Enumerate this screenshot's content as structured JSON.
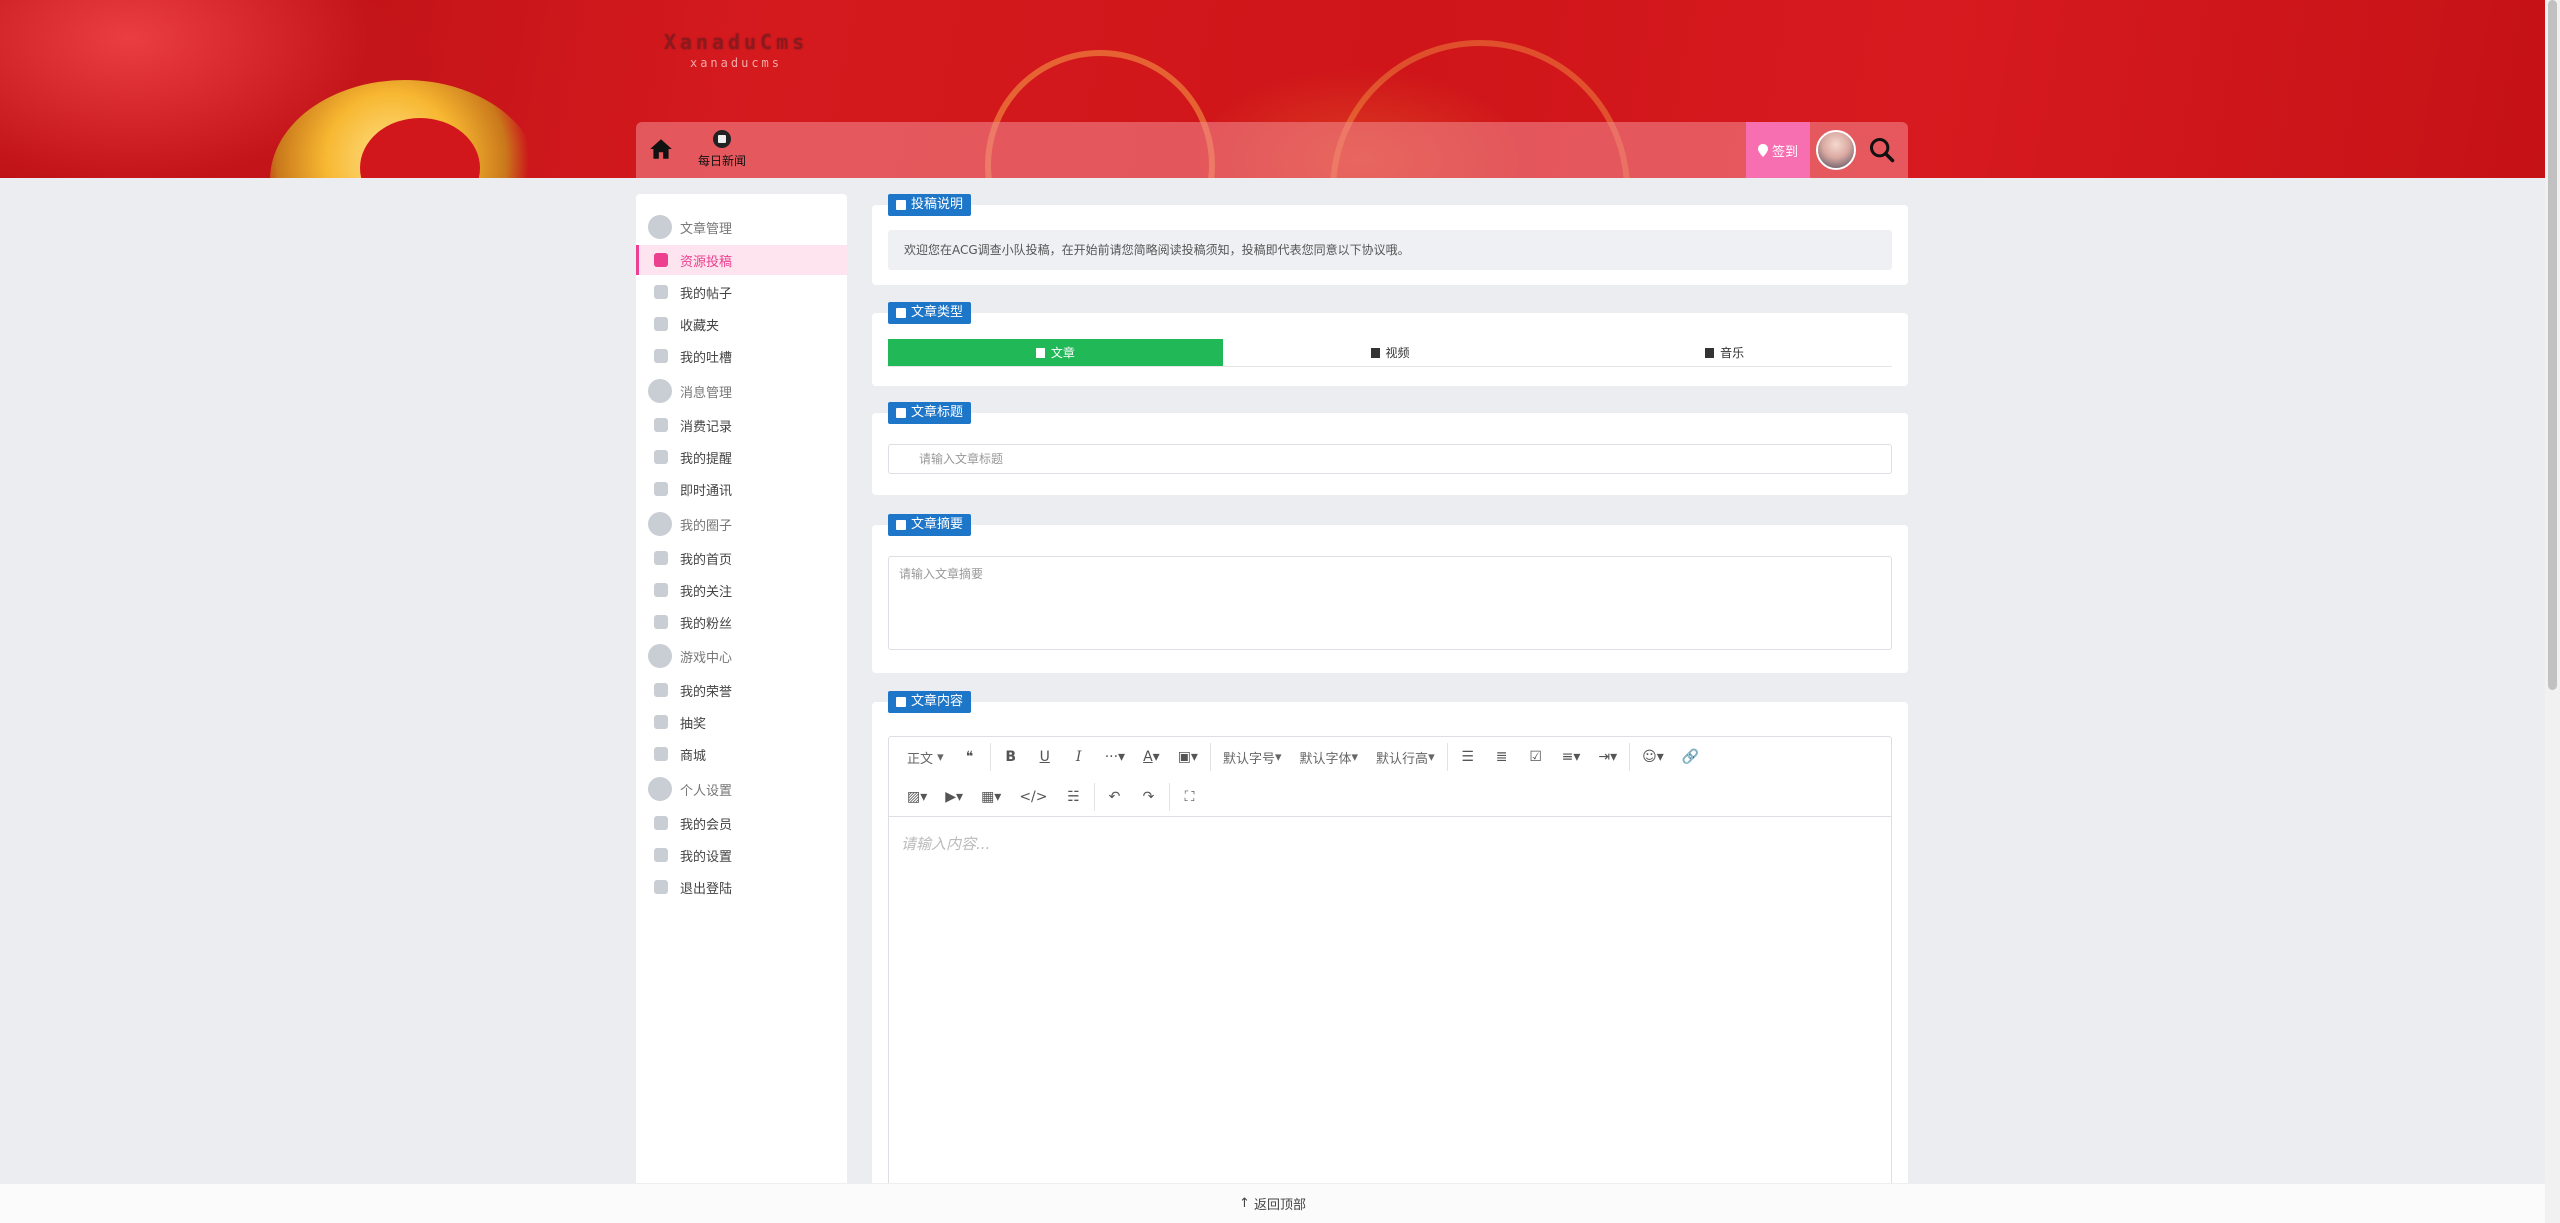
{
  "header": {
    "logo_title": "XanaduCms",
    "logo_sub": "xanaducms",
    "nav_news_label": "每日新闻",
    "signin_label": "签到"
  },
  "sidebar": {
    "items": [
      {
        "label": "文章管理",
        "group": true,
        "icon": "pencil-icon"
      },
      {
        "label": "资源投稿",
        "active": true,
        "icon": "brush-icon"
      },
      {
        "label": "我的帖子",
        "icon": "chat-icon"
      },
      {
        "label": "收藏夹",
        "icon": "heart-icon"
      },
      {
        "label": "我的吐槽",
        "icon": "comments-icon"
      },
      {
        "label": "消息管理",
        "group": true,
        "icon": "bell-icon"
      },
      {
        "label": "消费记录",
        "icon": "history-icon"
      },
      {
        "label": "我的提醒",
        "icon": "bell-icon"
      },
      {
        "label": "即时通讯",
        "icon": "envelope-icon"
      },
      {
        "label": "我的圈子",
        "group": true,
        "icon": "circle-icon"
      },
      {
        "label": "我的首页",
        "icon": "circle-icon"
      },
      {
        "label": "我的关注",
        "icon": "users-icon"
      },
      {
        "label": "我的粉丝",
        "icon": "users-icon"
      },
      {
        "label": "游戏中心",
        "group": true,
        "icon": "gamepad-icon"
      },
      {
        "label": "我的荣誉",
        "icon": "bookmark-icon"
      },
      {
        "label": "抽奖",
        "icon": "gift-icon"
      },
      {
        "label": "商城",
        "icon": "gift-icon"
      },
      {
        "label": "个人设置",
        "group": true,
        "icon": "id-card-icon"
      },
      {
        "label": "我的会员",
        "icon": "id-card-icon"
      },
      {
        "label": "我的设置",
        "icon": "gear-icon"
      },
      {
        "label": "退出登陆",
        "icon": "power-icon"
      }
    ]
  },
  "notice": {
    "title": "投稿说明",
    "text": "欢迎您在ACG调查小队投稿，在开始前请您简略阅读投稿须知，投稿即代表您同意以下协议哦。"
  },
  "type_section": {
    "title": "文章类型",
    "types": [
      "文章",
      "视频",
      "音乐"
    ],
    "selected": "文章"
  },
  "title_section": {
    "title": "文章标题",
    "placeholder": "请输入文章标题"
  },
  "summary_section": {
    "title": "文章摘要",
    "placeholder": "请输入文章摘要"
  },
  "content_section": {
    "title": "文章内容",
    "toolbar": {
      "paragraph": "正文",
      "font_size": "默认字号",
      "font_family": "默认字体",
      "line_height": "默认行高"
    },
    "placeholder": "请输入内容..."
  },
  "footer": {
    "back_to_top": "返回顶部"
  },
  "colors": {
    "banner_red": "#d51a1e",
    "accent_pink": "#ec3f8f",
    "signin_pink": "#f76eb1",
    "section_blue": "#1e76c8",
    "selected_green": "#21b957"
  }
}
